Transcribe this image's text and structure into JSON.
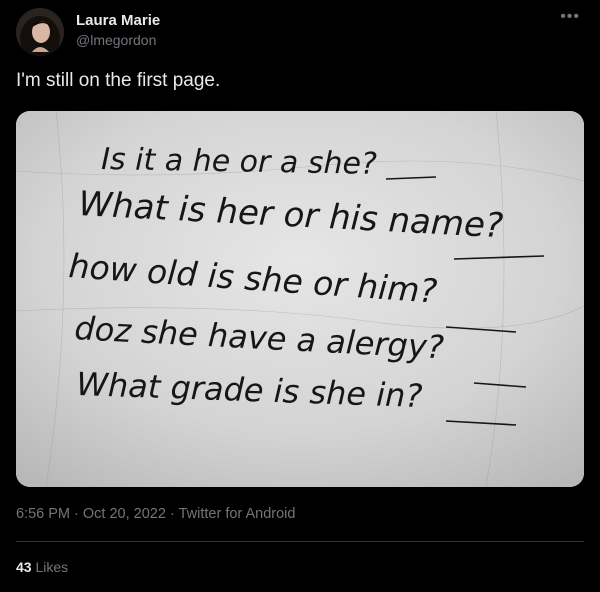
{
  "author": {
    "name": "Laura Marie",
    "handle": "@lmegordon"
  },
  "more_icon": "more-horizontal-icon",
  "tweet_text": "I'm still on the first page.",
  "media": {
    "handwriting_lines": [
      "Is it a he or a she?",
      "What is her or his name?",
      "how old is she or him?",
      "doz she have a alergy?",
      "What grade is she in?"
    ]
  },
  "meta": {
    "time": "6:56 PM",
    "date": "Oct 20, 2022",
    "source": "Twitter for Android",
    "separator": "·"
  },
  "stats": {
    "likes_count": "43",
    "likes_label": "Likes"
  }
}
